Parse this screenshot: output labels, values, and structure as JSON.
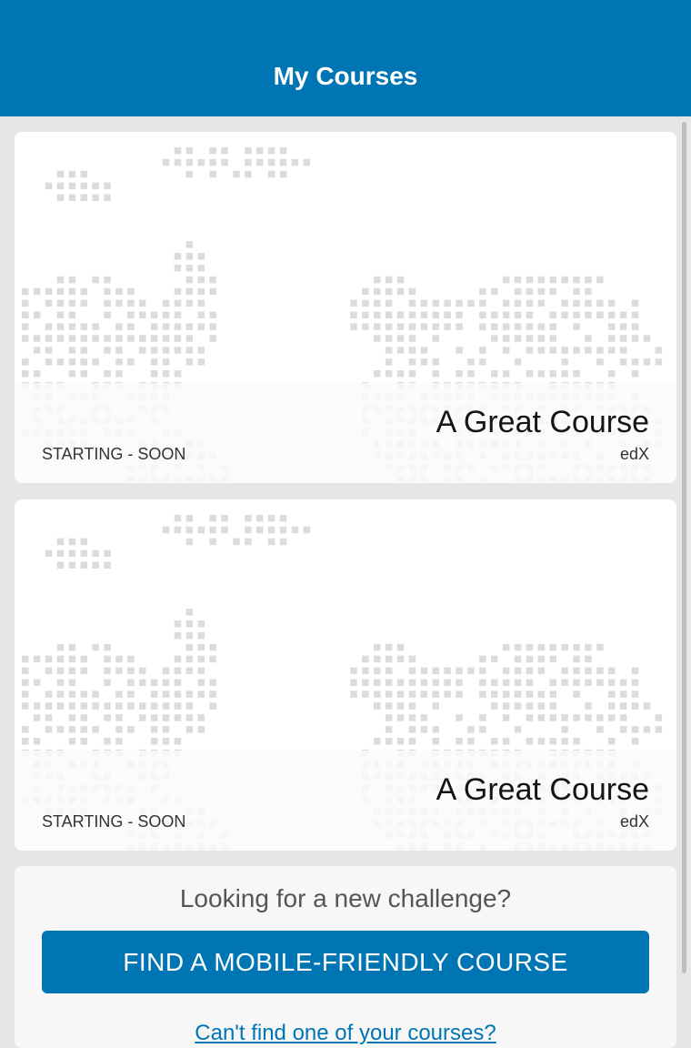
{
  "header": {
    "title": "My Courses"
  },
  "courses": [
    {
      "title": "A Great Course",
      "status": "STARTING - SOON",
      "org": "edX"
    },
    {
      "title": "A Great Course",
      "status": "STARTING - SOON",
      "org": "edX"
    }
  ],
  "find_panel": {
    "prompt": "Looking for a new challenge?",
    "button_label": "FIND A MOBILE-FRIENDLY COURSE",
    "missing_link": "Can't find one of your courses?"
  },
  "colors": {
    "brand": "#0075b4",
    "map_dots": "#dcdcdc",
    "card_bg": "#ffffff"
  },
  "icons": {
    "card_image": "world-map-dots"
  }
}
